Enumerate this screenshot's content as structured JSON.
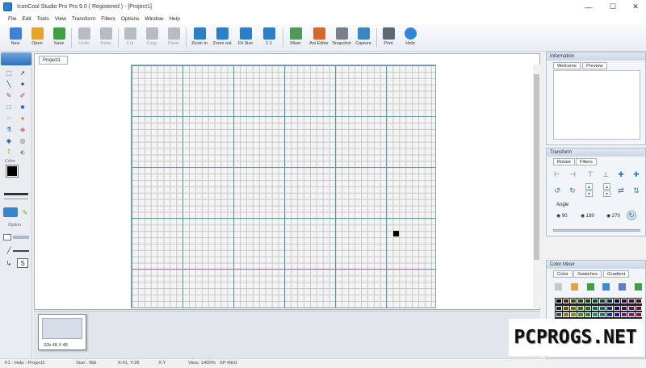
{
  "window": {
    "title": "IconCool Studio Pro Pro 9.0 ( Registered ) - [Project1]",
    "minimize": "—",
    "maximize": "☐",
    "close": "✕"
  },
  "menu": [
    "File",
    "Edit",
    "Tools",
    "View",
    "Transform",
    "Filters",
    "Options",
    "Window",
    "Help"
  ],
  "toolbar": [
    {
      "label": "New",
      "icon": "new-file-icon",
      "color": "#3c82d8",
      "enabled": true
    },
    {
      "label": "Open",
      "icon": "open-folder-icon",
      "color": "#e6a52a",
      "enabled": true
    },
    {
      "label": "Save",
      "icon": "save-icon",
      "color": "#3fa043",
      "enabled": true
    },
    {
      "label": "Undo",
      "icon": "undo-icon",
      "color": "#b5bcc4",
      "enabled": false
    },
    {
      "label": "Redo",
      "icon": "redo-icon",
      "color": "#b5bcc4",
      "enabled": false
    },
    {
      "label": "Cut",
      "icon": "cut-icon",
      "color": "#b5bcc4",
      "enabled": false
    },
    {
      "label": "Copy",
      "icon": "copy-icon",
      "color": "#b5bcc4",
      "enabled": false
    },
    {
      "label": "Paste",
      "icon": "paste-icon",
      "color": "#b5bcc4",
      "enabled": false
    },
    {
      "label": "Zoom in",
      "icon": "zoom-in-icon",
      "color": "#2a7fc9",
      "enabled": true
    },
    {
      "label": "Zoom out",
      "icon": "zoom-out-icon",
      "color": "#2a7fc9",
      "enabled": true
    },
    {
      "label": "Fit Size",
      "icon": "fit-size-icon",
      "color": "#2a7fc9",
      "enabled": true
    },
    {
      "label": "1:1",
      "icon": "actual-size-icon",
      "color": "#2a7fc9",
      "enabled": true
    },
    {
      "label": "Mixer",
      "icon": "mixer-icon",
      "color": "#4c9a5a",
      "enabled": true
    },
    {
      "label": "Ani Editor",
      "icon": "ani-editor-icon",
      "color": "#d46a2a",
      "enabled": true
    },
    {
      "label": "Snapshot",
      "icon": "snapshot-icon",
      "color": "#777f8a",
      "enabled": true
    },
    {
      "label": "Capture",
      "icon": "capture-icon",
      "color": "#3a87c8",
      "enabled": true
    },
    {
      "label": "Print",
      "icon": "print-icon",
      "color": "#5d6873",
      "enabled": true
    },
    {
      "label": "Help",
      "icon": "help-icon",
      "color": "#2d86d6",
      "enabled": true
    }
  ],
  "left": {
    "color_label": "Color",
    "option_label": "Option"
  },
  "document": {
    "tab": "Project1"
  },
  "thumbnail": {
    "caption": "32b  48 X 48"
  },
  "panels": {
    "information": {
      "title": "Information",
      "tabs": [
        "Welcome",
        "Preview"
      ]
    },
    "transform": {
      "title": "Transform",
      "tabs": [
        "Rotate",
        "Filters"
      ],
      "angle_label": "Angle",
      "angles": [
        "90",
        "180",
        "270"
      ]
    },
    "colormixer": {
      "title": "Color Mixer",
      "tabs": [
        "Color",
        "Swatches",
        "Gradient"
      ]
    }
  },
  "status": {
    "f1": "F1 : Help : Project1",
    "size": "Size : 9kb",
    "coord": "X:41, Y:26",
    "xy": "X:Y",
    "view": "View: 1400%",
    "mode": "XP REG"
  },
  "watermark": "PCPROGS.NET"
}
